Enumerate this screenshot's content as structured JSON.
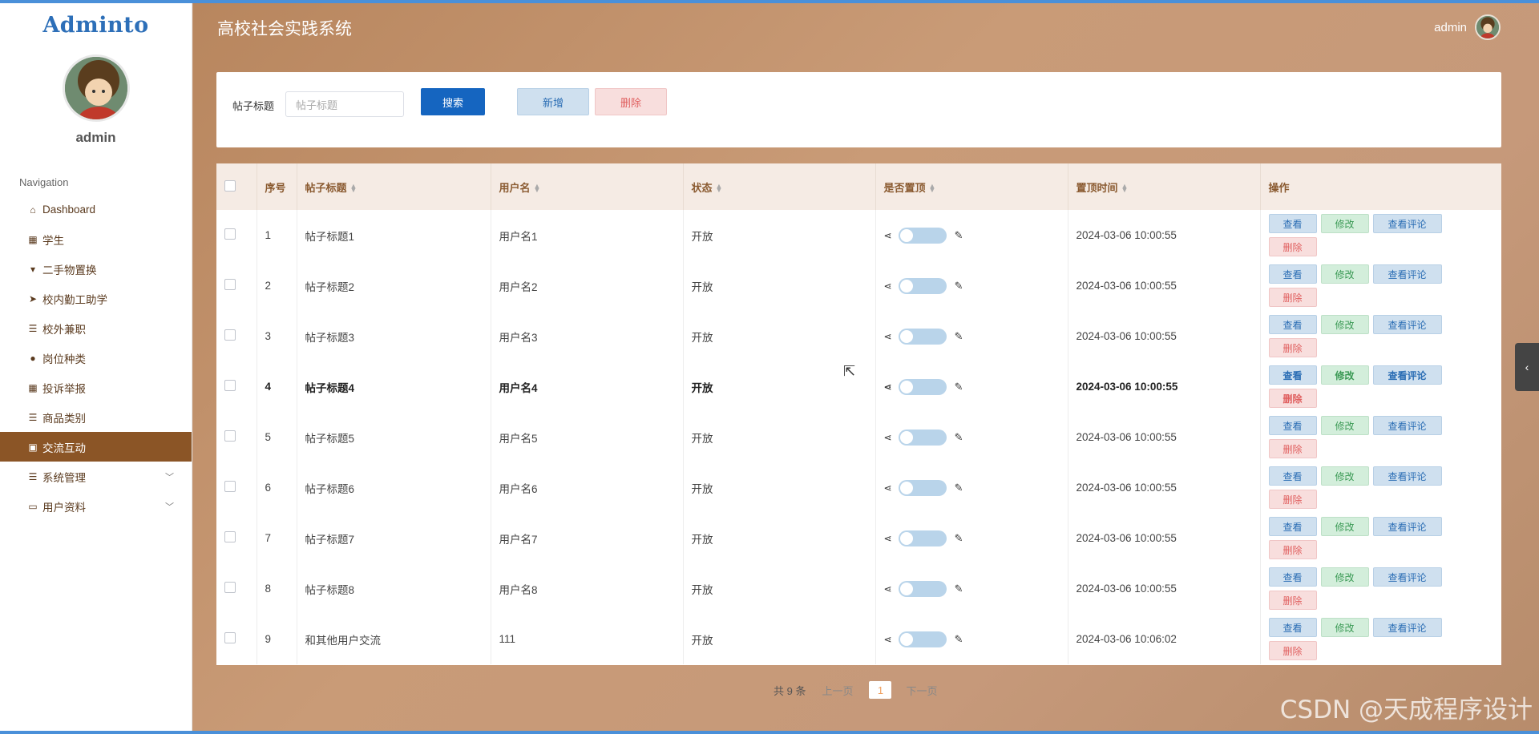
{
  "app": {
    "logo": "Adminto",
    "title": "高校社会实践系统",
    "user": "admin"
  },
  "sidebar": {
    "user": "admin",
    "nav_title": "Navigation",
    "items": [
      {
        "label": "Dashboard",
        "icon": "home-icon"
      },
      {
        "label": "学生",
        "icon": "grid-icon"
      },
      {
        "label": "二手物置换",
        "icon": "flag-icon"
      },
      {
        "label": "校内勤工助学",
        "icon": "send-icon"
      },
      {
        "label": "校外兼职",
        "icon": "sliders-icon"
      },
      {
        "label": "岗位种类",
        "icon": "bulb-icon"
      },
      {
        "label": "投诉举报",
        "icon": "grid-icon"
      },
      {
        "label": "商品类别",
        "icon": "list-icon"
      },
      {
        "label": "交流互动",
        "icon": "ticket-icon",
        "active": true
      },
      {
        "label": "系统管理",
        "icon": "list-icon",
        "expandable": true
      },
      {
        "label": "用户资料",
        "icon": "card-icon",
        "expandable": true
      }
    ]
  },
  "search": {
    "label": "帖子标题",
    "placeholder": "帖子标题",
    "search_btn": "搜索",
    "add_btn": "新增",
    "delete_btn": "删除"
  },
  "table": {
    "headers": [
      "序号",
      "帖子标题",
      "用户名",
      "状态",
      "是否置顶",
      "置顶时间",
      "操作"
    ],
    "rows": [
      {
        "no": "1",
        "title": "帖子标题1",
        "user": "用户名1",
        "status": "开放",
        "time": "2024-03-06 10:00:55"
      },
      {
        "no": "2",
        "title": "帖子标题2",
        "user": "用户名2",
        "status": "开放",
        "time": "2024-03-06 10:00:55"
      },
      {
        "no": "3",
        "title": "帖子标题3",
        "user": "用户名3",
        "status": "开放",
        "time": "2024-03-06 10:00:55"
      },
      {
        "no": "4",
        "title": "帖子标题4",
        "user": "用户名4",
        "status": "开放",
        "time": "2024-03-06 10:00:55"
      },
      {
        "no": "5",
        "title": "帖子标题5",
        "user": "用户名5",
        "status": "开放",
        "time": "2024-03-06 10:00:55"
      },
      {
        "no": "6",
        "title": "帖子标题6",
        "user": "用户名6",
        "status": "开放",
        "time": "2024-03-06 10:00:55"
      },
      {
        "no": "7",
        "title": "帖子标题7",
        "user": "用户名7",
        "status": "开放",
        "time": "2024-03-06 10:00:55"
      },
      {
        "no": "8",
        "title": "帖子标题8",
        "user": "用户名8",
        "status": "开放",
        "time": "2024-03-06 10:00:55"
      },
      {
        "no": "9",
        "title": "和其他用户交流",
        "user": "111",
        "status": "开放",
        "time": "2024-03-06 10:06:02"
      }
    ],
    "actions": {
      "view": "查看",
      "edit": "修改",
      "comments": "查看评论",
      "delete": "删除"
    }
  },
  "pager": {
    "total": "共 9 条",
    "prev": "上一页",
    "current": "1",
    "next": "下一页"
  },
  "watermark": "CSDN @天成程序设计",
  "colors": {
    "accent": "#8b5526",
    "primary_btn": "#1565c0"
  }
}
